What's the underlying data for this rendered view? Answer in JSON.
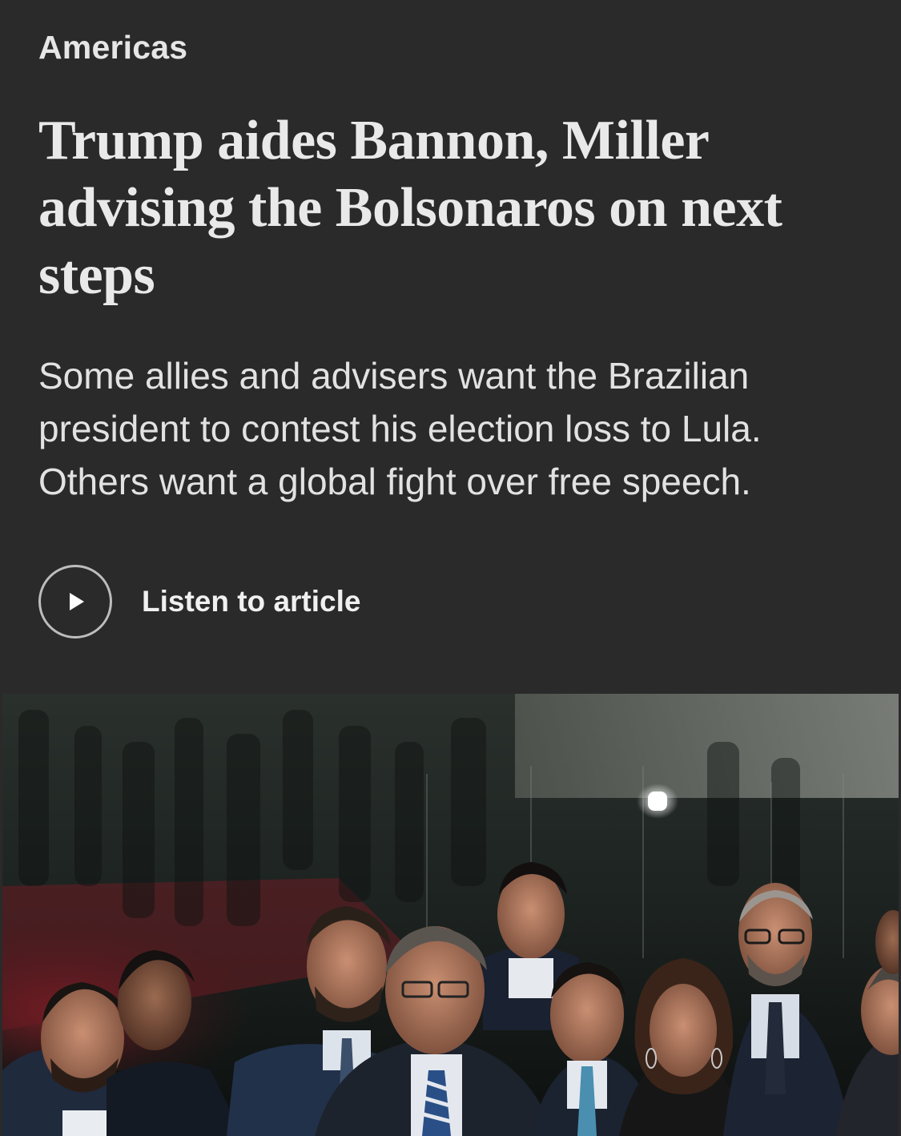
{
  "article": {
    "section": "Americas",
    "headline": "Trump aides Bannon, Miller advising the Bolsonaros on next steps",
    "dek": "Some allies and advisers want the Brazilian president to contest his election loss to Lula. Others want a global fight over free speech.",
    "listen_label": "Listen to article",
    "play_icon": "play-icon"
  },
  "colors": {
    "background": "#2a2a2a",
    "text": "#e9e9e9",
    "circle_border": "#bdbdbd"
  }
}
